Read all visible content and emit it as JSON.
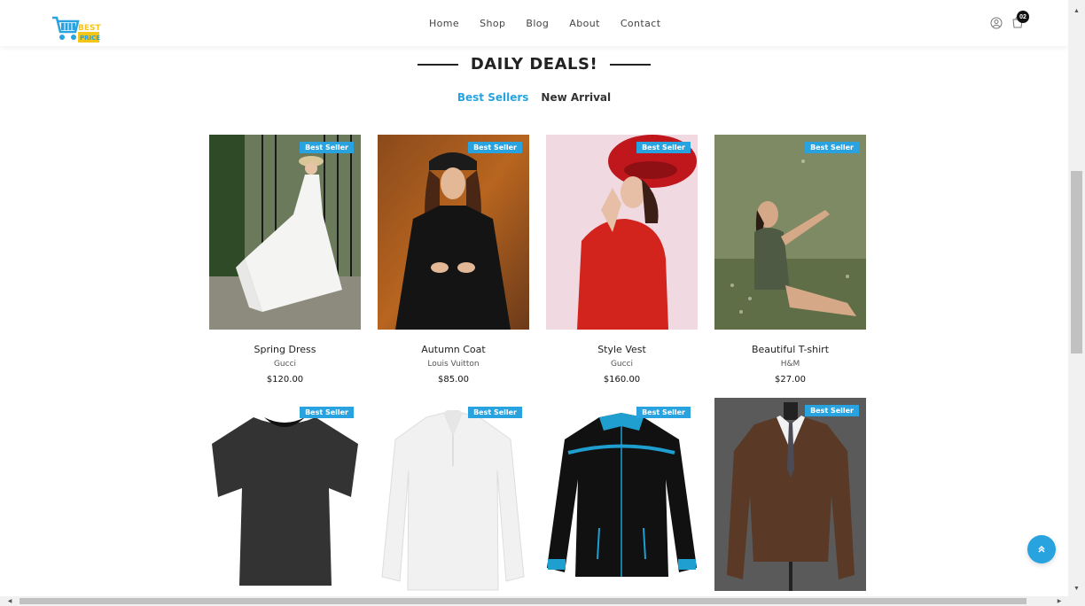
{
  "logo": {
    "line1": "BEST",
    "line2": "PRICE",
    "blue": "#29a3e0",
    "yellow": "#f5c518"
  },
  "nav": [
    "Home",
    "Shop",
    "Blog",
    "About",
    "Contact"
  ],
  "cart_count": "02",
  "section_title": "DAILY DEALS!",
  "tabs": {
    "active": "Best Sellers",
    "inactive": "New Arrival"
  },
  "accent": "#29a3e0",
  "badge_label": "Best Seller",
  "products": [
    {
      "name": "Spring Dress",
      "brand": "Gucci",
      "price": "$120.00"
    },
    {
      "name": "Autumn Coat",
      "brand": "Louis Vuitton",
      "price": "$85.00"
    },
    {
      "name": "Style Vest",
      "brand": "Gucci",
      "price": "$160.00"
    },
    {
      "name": "Beautiful T-shirt",
      "brand": "H&M",
      "price": "$27.00"
    }
  ],
  "badges": [
    "Best Seller",
    "Best Seller",
    "Best Seller",
    "Best Seller",
    "Best Seller",
    "Best Seller",
    "Best Seller",
    "Best Seller"
  ],
  "icons": {
    "user": "user-icon",
    "cart": "cart-icon",
    "scroll_top": "double-chevron-up-icon"
  }
}
